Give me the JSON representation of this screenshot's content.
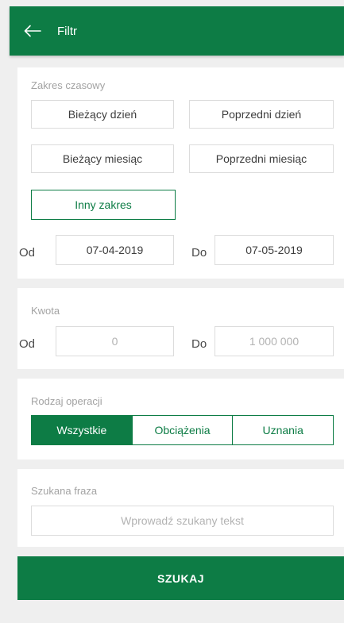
{
  "header": {
    "title": "Filtr",
    "back_icon": "arrow-left-icon",
    "color": "#0d7c45"
  },
  "time_range": {
    "label": "Zakres czasowy",
    "options": [
      {
        "label": "Bieżący dzień",
        "selected": false
      },
      {
        "label": "Poprzedni dzień",
        "selected": false
      },
      {
        "label": "Bieżący miesiąc",
        "selected": false
      },
      {
        "label": "Poprzedni miesiąc",
        "selected": false
      },
      {
        "label": "Inny zakres",
        "selected": true
      }
    ],
    "from_label": "Od",
    "from_value": "07-04-2019",
    "to_label": "Do",
    "to_value": "07-05-2019"
  },
  "amount": {
    "label": "Kwota",
    "from_label": "Od",
    "from_placeholder": "0",
    "to_label": "Do",
    "to_placeholder": "1 000 000"
  },
  "operation_type": {
    "label": "Rodzaj operacji",
    "options": [
      {
        "label": "Wszystkie",
        "active": true
      },
      {
        "label": "Obciążenia",
        "active": false
      },
      {
        "label": "Uznania",
        "active": false
      }
    ]
  },
  "phrase": {
    "label": "Szukana fraza",
    "placeholder": "Wprowadź szukany tekst"
  },
  "search_button": {
    "label": "SZUKAJ"
  }
}
